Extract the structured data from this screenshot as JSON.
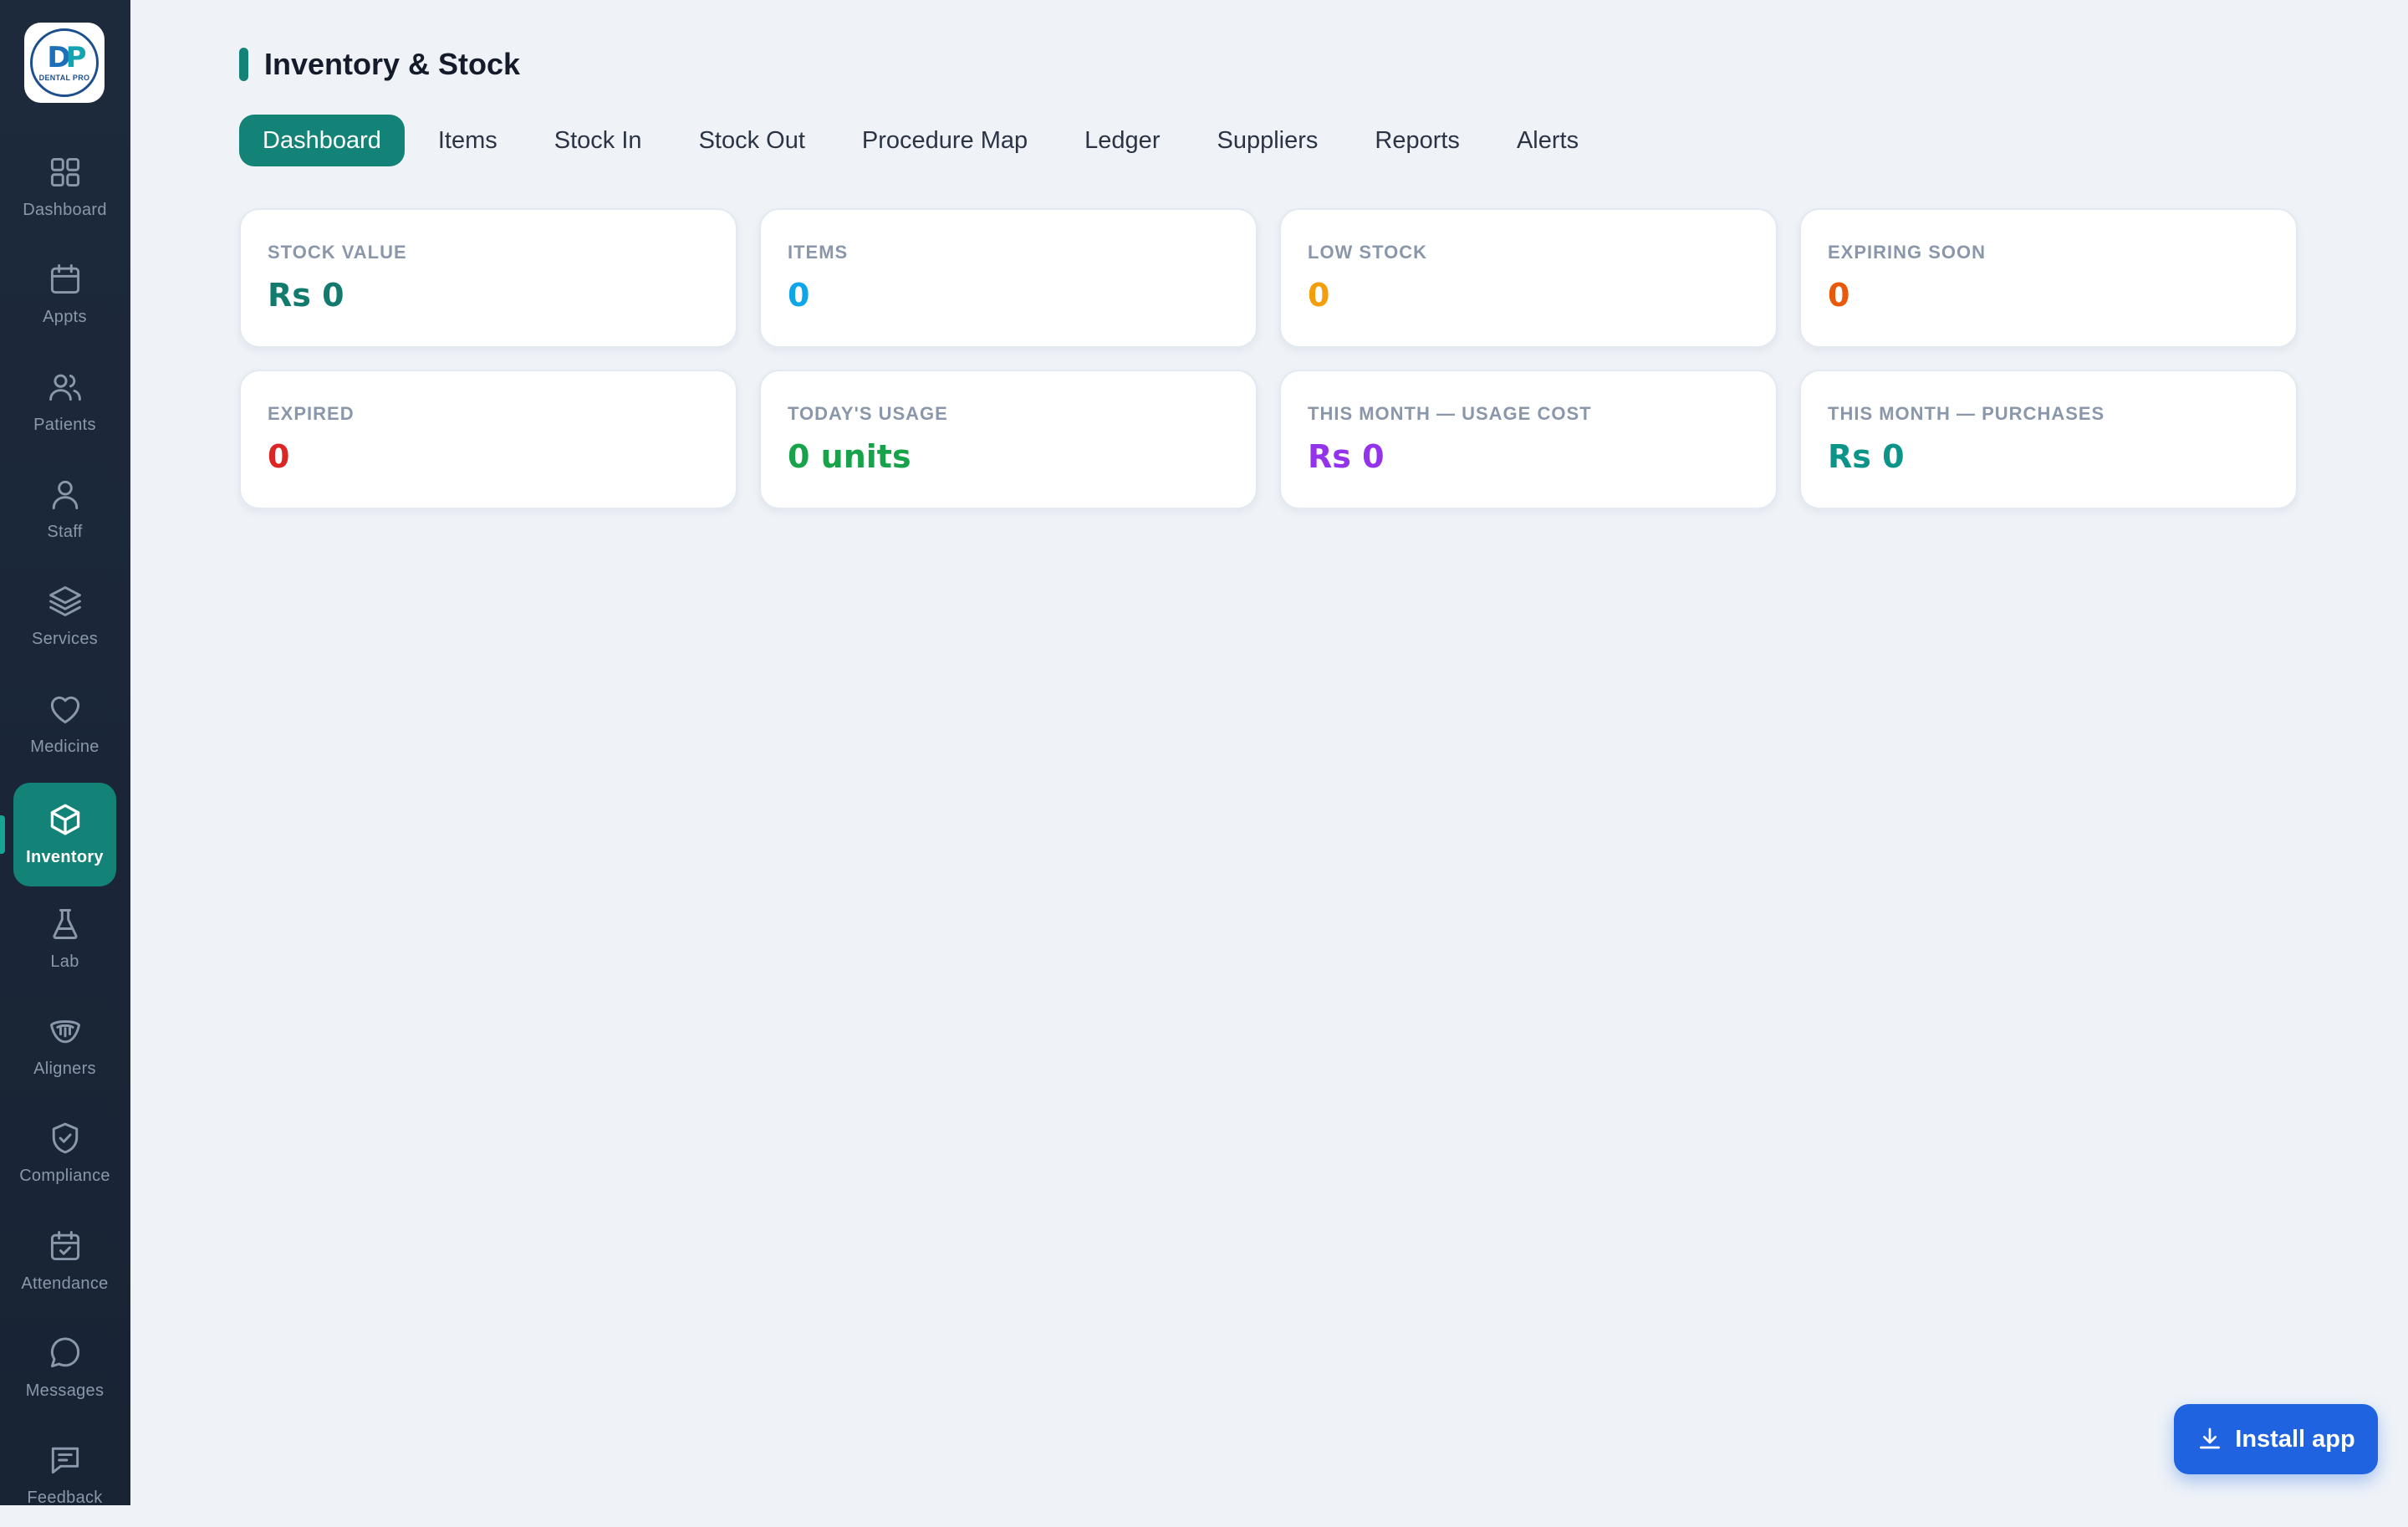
{
  "app": {
    "logo": {
      "mark_left": "D",
      "mark_right": "P",
      "word": "DENTAL PRO",
      "tagline": ""
    }
  },
  "sidebar": {
    "items": [
      {
        "label": "Dashboard",
        "icon": "grid-icon"
      },
      {
        "label": "Appts",
        "icon": "calendar-icon"
      },
      {
        "label": "Patients",
        "icon": "users-icon"
      },
      {
        "label": "Staff",
        "icon": "user-icon"
      },
      {
        "label": "Services",
        "icon": "layers-icon"
      },
      {
        "label": "Medicine",
        "icon": "heart-icon"
      },
      {
        "label": "Inventory",
        "icon": "box-icon",
        "active": true
      },
      {
        "label": "Lab",
        "icon": "flask-icon"
      },
      {
        "label": "Aligners",
        "icon": "aligner-icon"
      },
      {
        "label": "Compliance",
        "icon": "shield-check-icon"
      },
      {
        "label": "Attendance",
        "icon": "calendar-check-icon"
      },
      {
        "label": "Messages",
        "icon": "message-icon"
      },
      {
        "label": "Feedback",
        "icon": "feedback-icon"
      }
    ]
  },
  "header": {
    "title": "Inventory & Stock"
  },
  "tabs": [
    {
      "label": "Dashboard",
      "active": true
    },
    {
      "label": "Items"
    },
    {
      "label": "Stock In"
    },
    {
      "label": "Stock Out"
    },
    {
      "label": "Procedure Map"
    },
    {
      "label": "Ledger"
    },
    {
      "label": "Suppliers"
    },
    {
      "label": "Reports"
    },
    {
      "label": "Alerts"
    }
  ],
  "cards": [
    {
      "label": "STOCK VALUE",
      "value": "Rs 0",
      "color": "#137a6e"
    },
    {
      "label": "ITEMS",
      "value": "0",
      "color": "#0ea5e9"
    },
    {
      "label": "LOW STOCK",
      "value": "0",
      "color": "#f59e0b"
    },
    {
      "label": "EXPIRING SOON",
      "value": "0",
      "color": "#ea580c"
    },
    {
      "label": "EXPIRED",
      "value": "0",
      "color": "#dc2626"
    },
    {
      "label": "TODAY'S USAGE",
      "value": "0 units",
      "color": "#16a34a"
    },
    {
      "label": "THIS MONTH — USAGE COST",
      "value": "Rs 0",
      "color": "#9333ea"
    },
    {
      "label": "THIS MONTH — PURCHASES",
      "value": "Rs 0",
      "color": "#0d9488"
    }
  ],
  "install_button": {
    "label": "Install app",
    "icon": "download-icon"
  },
  "colors": {
    "accent": "#138277",
    "sidebar_bg": "#1d2a3c",
    "install": "#1f63e0"
  }
}
